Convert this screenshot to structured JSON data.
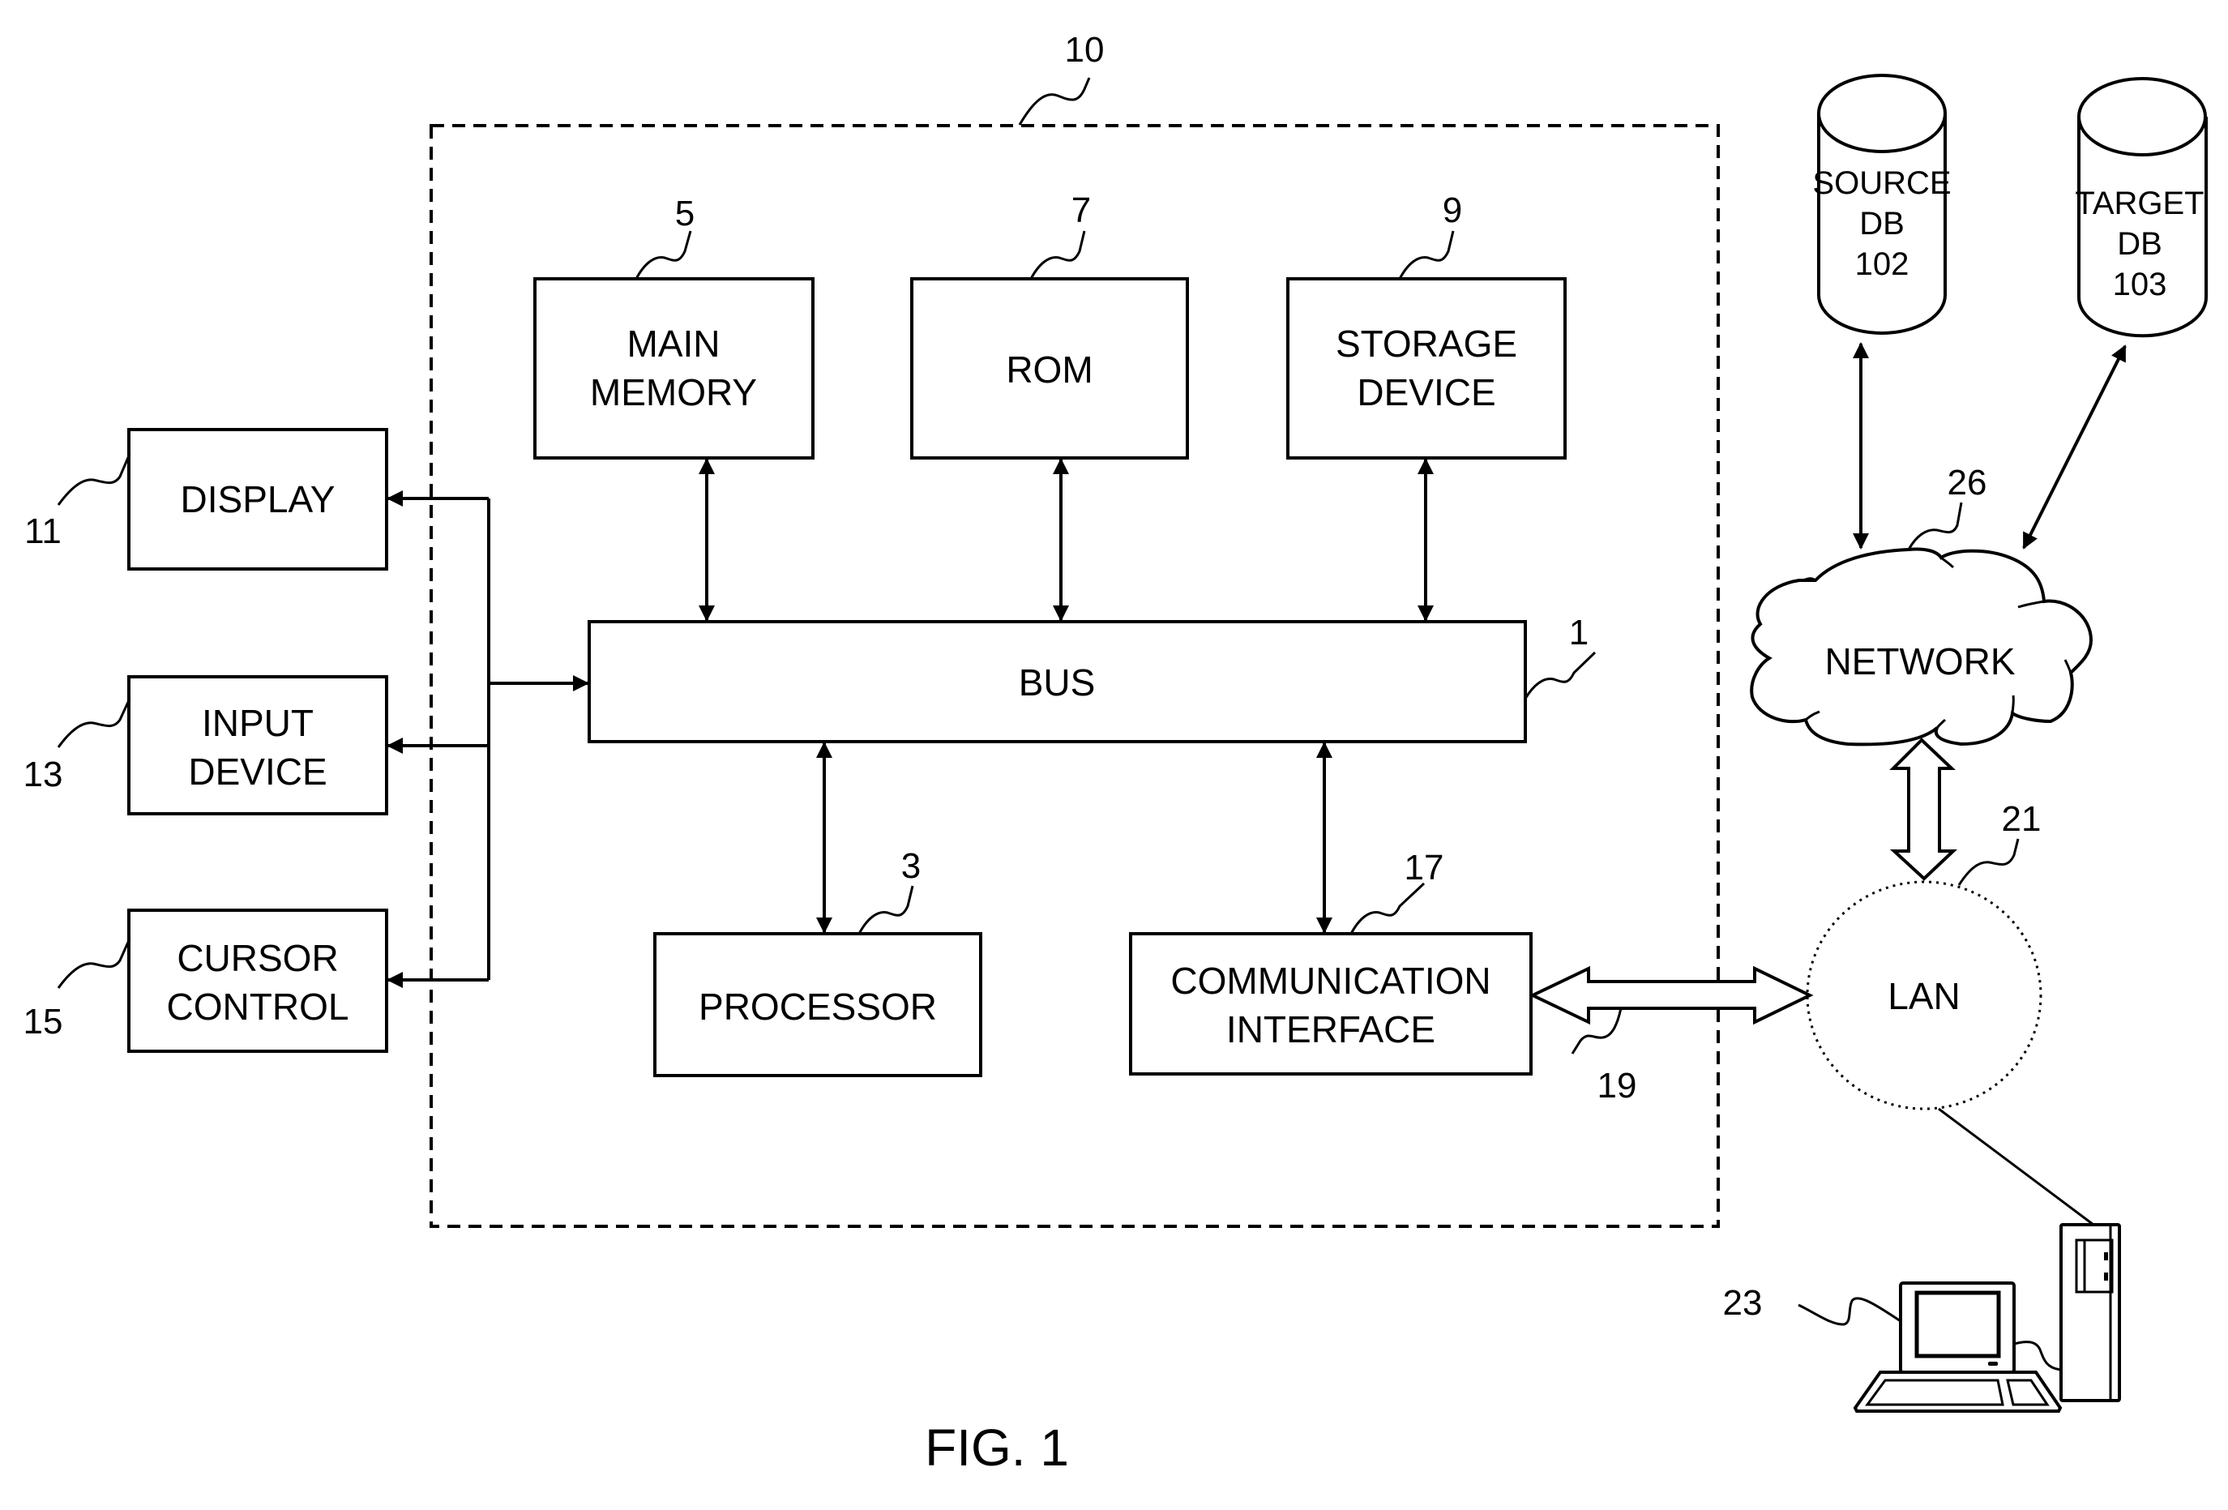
{
  "figure": {
    "caption": "FIG. 1",
    "computer_system": {
      "ref": "10",
      "components": {
        "bus": {
          "label": "BUS",
          "ref": "1"
        },
        "processor": {
          "label": "PROCESSOR",
          "ref": "3"
        },
        "main_memory": {
          "line1": "MAIN",
          "line2": "MEMORY",
          "ref": "5"
        },
        "rom": {
          "label": "ROM",
          "ref": "7"
        },
        "storage_device": {
          "line1": "STORAGE",
          "line2": "DEVICE",
          "ref": "9"
        },
        "communication_interface": {
          "line1": "COMMUNICATION",
          "line2": "INTERFACE",
          "ref": "17"
        }
      }
    },
    "peripherals": {
      "display": {
        "label": "DISPLAY",
        "ref": "11"
      },
      "input_device": {
        "line1": "INPUT",
        "line2": "DEVICE",
        "ref": "13"
      },
      "cursor_control": {
        "line1": "CURSOR",
        "line2": "CONTROL",
        "ref": "15"
      }
    },
    "network_link": {
      "ref": "19"
    },
    "lan": {
      "label": "LAN",
      "ref": "21"
    },
    "workstation": {
      "ref": "23"
    },
    "network": {
      "label": "NETWORK",
      "ref": "26"
    },
    "source_db": {
      "line1": "SOURCE",
      "line2": "DB",
      "line3": "102"
    },
    "target_db": {
      "line1": "TARGET",
      "line2": "DB",
      "line3": "103"
    }
  }
}
